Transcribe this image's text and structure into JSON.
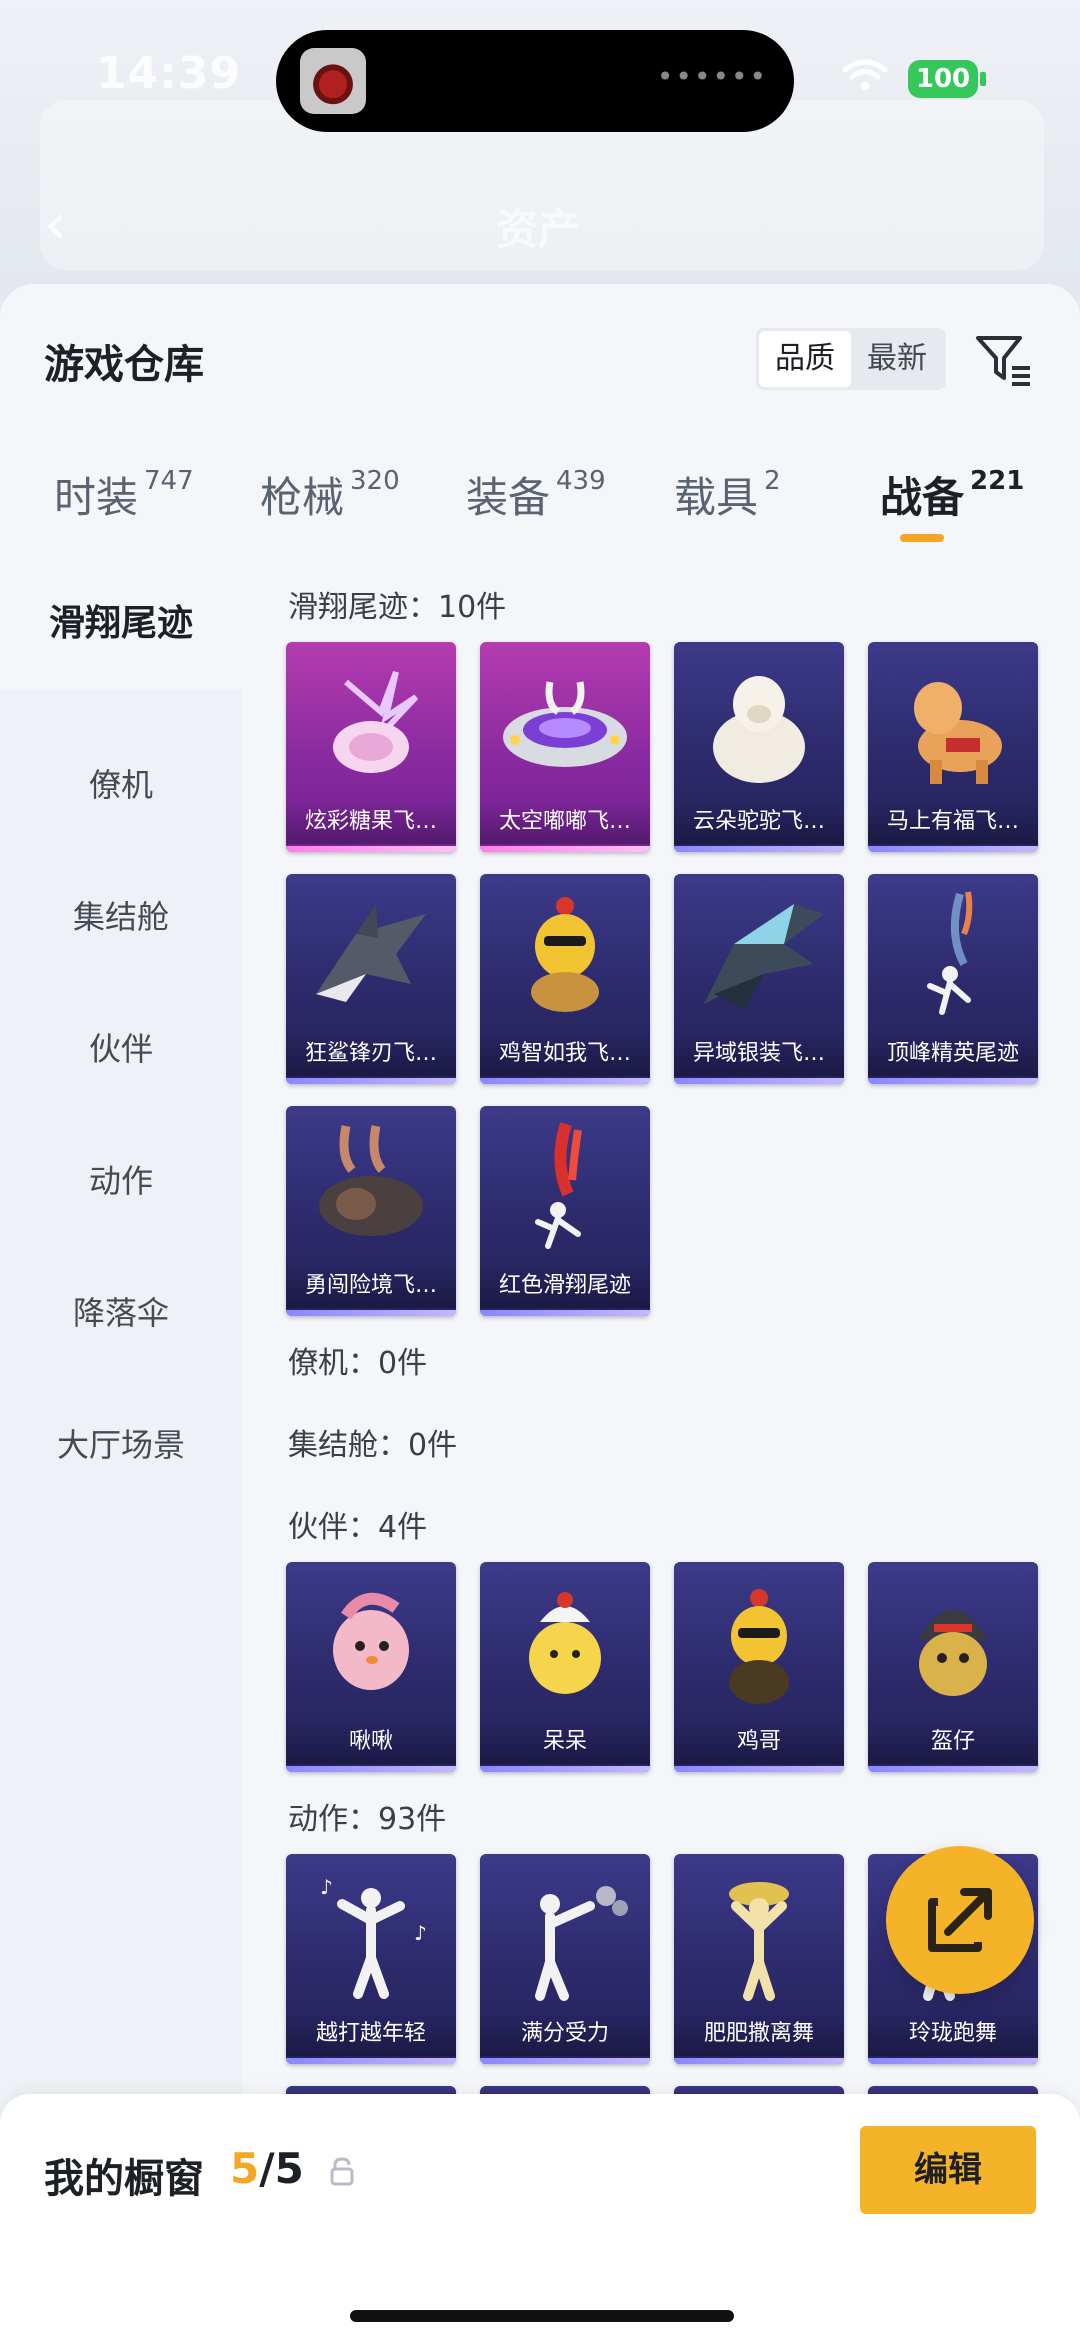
{
  "status_bar": {
    "time": "14:39",
    "battery": "100"
  },
  "background_page": {
    "title": "资产"
  },
  "header": {
    "title": "游戏仓库",
    "sort_options": [
      "品质",
      "最新"
    ]
  },
  "tabs": [
    {
      "label": "时装",
      "count": "747"
    },
    {
      "label": "枪械",
      "count": "320"
    },
    {
      "label": "装备",
      "count": "439"
    },
    {
      "label": "载具",
      "count": "2"
    },
    {
      "label": "战备",
      "count": "221"
    }
  ],
  "sidenav": [
    "滑翔尾迹",
    "僚机",
    "集结舱",
    "伙伴",
    "动作",
    "降落伞",
    "大厅场景"
  ],
  "sections": {
    "trail": {
      "heading": "滑翔尾迹：10件",
      "items": [
        "炫彩糖果飞…",
        "太空嘟嘟飞…",
        "云朵驼驼飞…",
        "马上有福飞…",
        "狂鲨锋刃飞…",
        "鸡智如我飞…",
        "异域银装飞…",
        "顶峰精英尾迹",
        "勇闯险境飞…",
        "红色滑翔尾迹"
      ]
    },
    "wingman": {
      "heading": "僚机：0件"
    },
    "pod": {
      "heading": "集结舱：0件"
    },
    "partner": {
      "heading": "伙伴：4件",
      "items": [
        "啾啾",
        "呆呆",
        "鸡哥",
        "盔仔"
      ]
    },
    "emote": {
      "heading": "动作：93件",
      "items": [
        "越打越年轻",
        "满分受力",
        "肥肥撒离舞",
        "玲珑跑舞"
      ]
    }
  },
  "bottom_bar": {
    "label": "我的橱窗",
    "current": "5",
    "total": "/5",
    "edit_label": "编辑"
  }
}
